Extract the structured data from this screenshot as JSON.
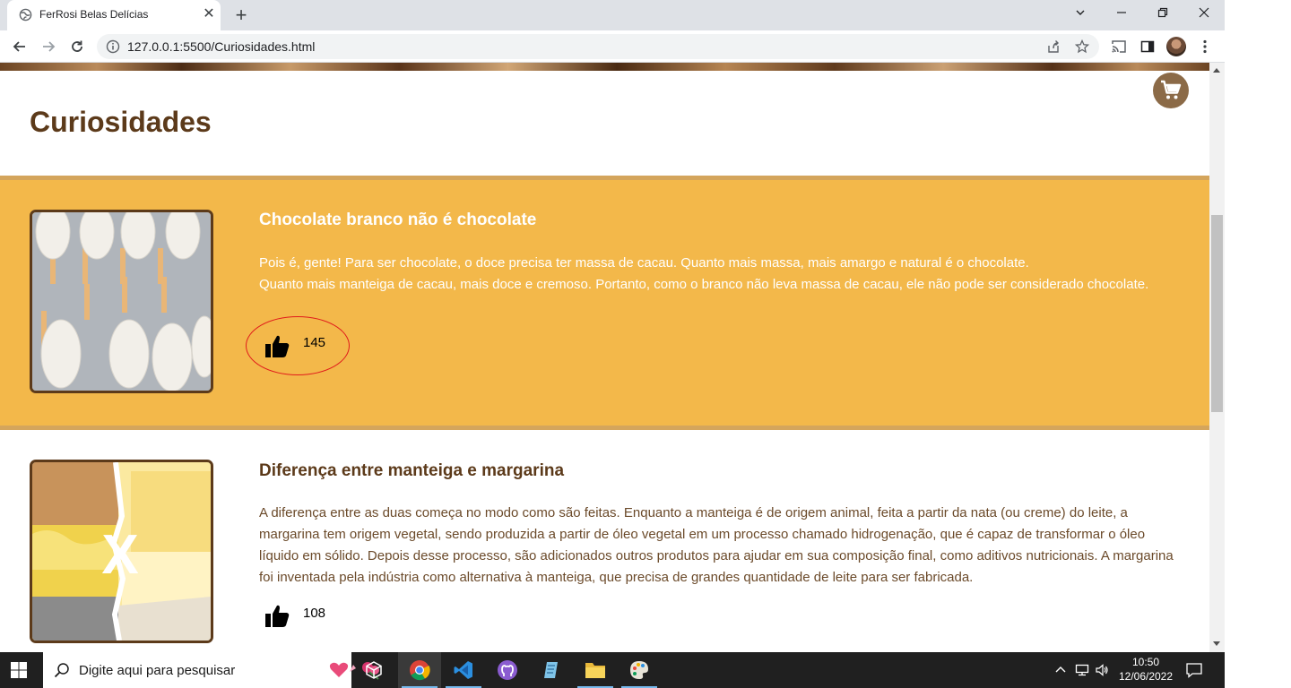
{
  "browser": {
    "tab_title": "FerRosi Belas Delícias",
    "url": "127.0.0.1:5500/Curiosidades.html"
  },
  "page": {
    "title": "Curiosidades",
    "cards": [
      {
        "title": "Chocolate branco não é chocolate",
        "text_line1": "Pois é, gente! Para ser chocolate, o doce precisa ter massa de cacau. Quanto mais massa, mais amargo e natural é o chocolate.",
        "text_line2": "Quanto mais manteiga de cacau, mais doce e cremoso. Portanto, como o branco não leva massa de cacau, ele não pode ser considerado chocolate.",
        "likes": "145"
      },
      {
        "title": "Diferença entre manteiga e margarina",
        "text": "A diferença entre as duas começa no modo como são feitas. Enquanto a manteiga é de origem animal, feita a partir da nata (ou creme) do leite, a margarina tem origem vegetal, sendo produzida a partir de óleo vegetal em um processo chamado hidrogenação, que é capaz de transformar o óleo líquido em sólido. Depois desse processo, são adicionados outros produtos para ajudar em sua composição final, como aditivos nutricionais. A margarina foi inventada pela indústria como alternativa à manteiga, que precisa de grandes quantidade de leite para ser fabricada.",
        "likes": "108",
        "image_label": "X"
      }
    ]
  },
  "taskbar": {
    "search_placeholder": "Digite aqui para pesquisar",
    "time": "10:50",
    "date": "12/06/2022"
  },
  "colors": {
    "accent": "#f3b84a",
    "brand_brown": "#5c3a1a",
    "highlight": "#e01b1b"
  }
}
